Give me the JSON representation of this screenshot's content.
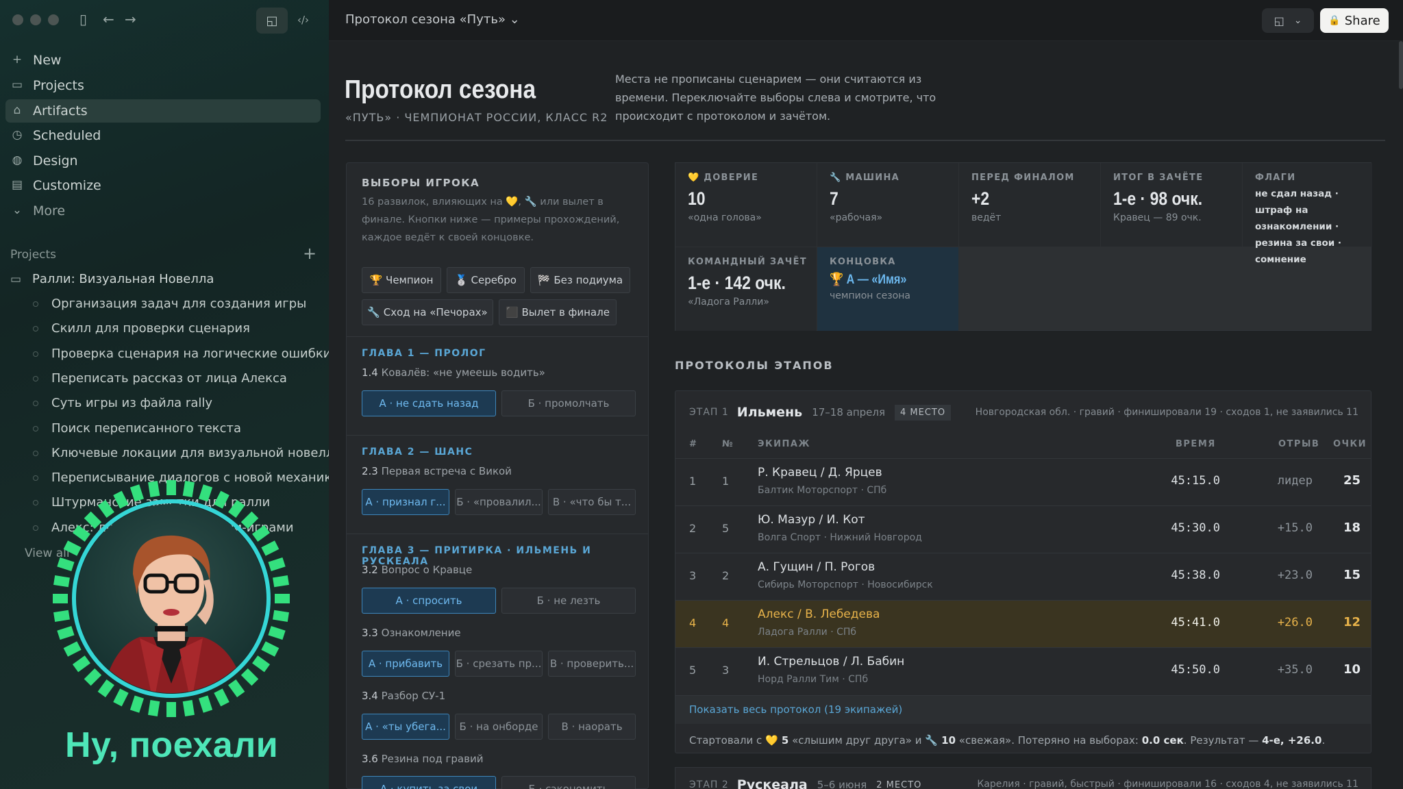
{
  "sidebar": {
    "nav": [
      {
        "label": "New",
        "icon": "plus-icon"
      },
      {
        "label": "Projects",
        "icon": "folder-icon"
      },
      {
        "label": "Artifacts",
        "icon": "artifacts-icon"
      },
      {
        "label": "Scheduled",
        "icon": "clock-icon"
      },
      {
        "label": "Design",
        "icon": "palette-icon"
      },
      {
        "label": "Customize",
        "icon": "briefcase-icon"
      },
      {
        "label": "More",
        "icon": "chevron-down-icon"
      }
    ],
    "projects_header": "Projects",
    "project_name": "Ралли: Визуальная Новелла",
    "items": [
      "Организация задач для создания игры",
      "Скилл для проверки сценария",
      "Проверка сценария на логические ошибки",
      "Переписать рассказ от лица Алекса",
      "Суть игры из файла rally",
      "Поиск переписанного текста",
      "Ключевые локации для визуальной новеллы",
      "Переписывание диалогов с новой механикой",
      "Штурманские заметки для ралли",
      "Алекс: диалоги с новой мини-играми"
    ],
    "view_all": "View all"
  },
  "overlay": {
    "caption": "Ну, поехали"
  },
  "topbar": {
    "title": "Протокол сезона «Путь» ⌄",
    "share": "Share"
  },
  "header": {
    "title": "Протокол сезона",
    "subtitle": "«ПУТЬ» · ЧЕМПИОНАТ РОССИИ, КЛАСС R2",
    "intro": "Места не прописаны сценарием — они считаются из времени. Переключайте выборы слева и смотрите, что происходит с протоколом и зачётом."
  },
  "choices": {
    "title": "ВЫБОРЫ ИГРОКА",
    "desc": "16 развилок, влияющих на 💛, 🔧 или вылет в финале. Кнопки ниже — примеры прохождений, каждое ведёт к своей концовке.",
    "presets": [
      "🏆 Чемпион",
      "🥈 Серебро",
      "🏁 Без подиума",
      "🔧 Сход на «Печорах»",
      "⬛ Вылет в финале"
    ],
    "chapters": [
      {
        "title": "ГЛАВА 1 — ПРОЛОГ",
        "questions": [
          {
            "num": "1.4",
            "text": "Ковалёв: «не умеешь водить»",
            "options": [
              "А · не сдать назад",
              "Б · промолчать"
            ]
          }
        ]
      },
      {
        "title": "ГЛАВА 2 — ШАНС",
        "questions": [
          {
            "num": "2.3",
            "text": "Первая встреча с Викой",
            "options": [
              "А · признал г...",
              "Б · «провалил...",
              "В · «что бы т..."
            ]
          }
        ]
      },
      {
        "title": "ГЛАВА 3 — ПРИТИРКА · ИЛЬМЕНЬ И РУСКЕАЛА",
        "questions": [
          {
            "num": "3.2",
            "text": "Вопрос о Кравце",
            "options": [
              "А · спросить",
              "Б · не лезть"
            ]
          },
          {
            "num": "3.3",
            "text": "Ознакомление",
            "options": [
              "А · прибавить",
              "Б · срезать пр...",
              "В · проверить..."
            ]
          },
          {
            "num": "3.4",
            "text": "Разбор СУ-1",
            "options": [
              "А · «ты убега...",
              "Б · на онборде",
              "В · наорать"
            ]
          },
          {
            "num": "3.6",
            "text": "Резина под гравий",
            "options": [
              "А · купить за свои",
              "Б · сэкономить"
            ]
          }
        ]
      }
    ]
  },
  "stats": [
    {
      "label": "💛 ДОВЕРИЕ",
      "value": "10",
      "note": "«одна голова»"
    },
    {
      "label": "🔧 МАШИНА",
      "value": "7",
      "note": "«рабочая»"
    },
    {
      "label": "ПЕРЕД ФИНАЛОМ",
      "value": "+2",
      "note": "ведёт"
    },
    {
      "label": "ИТОГ В ЗАЧЁТЕ",
      "value": "1-е · 98 очк.",
      "note": "Кравец — 89 очк."
    },
    {
      "label": "ФЛАГИ",
      "value": "не сдал назад · штраф на ознакомлении · резина за свои · сомнение"
    },
    {
      "label": "КОМАНДНЫЙ ЗАЧЁТ",
      "value": "1-е · 142 очк.",
      "note": "«Ладога Ралли»"
    },
    {
      "label": "КОНЦОВКА",
      "value": "🏆 А — «Имя»",
      "note": "чемпион сезона"
    }
  ],
  "protocols": {
    "title": "ПРОТОКОЛЫ ЭТАПОВ",
    "stage": {
      "prefix": "ЭТАП 1",
      "name": "Ильмень",
      "dates": "17–18 апреля",
      "place": "4 МЕСТО",
      "info": "Новгородская обл. · гравий · финишировали 19 · сходов 1, не заявились 11"
    },
    "columns": [
      "#",
      "№",
      "ЭКИПАЖ",
      "ВРЕМЯ",
      "ОТРЫВ",
      "ОЧКИ"
    ],
    "rows": [
      {
        "pos": "1",
        "num": "1",
        "crew": "Р. Кравец / Д. Ярцев",
        "team": "Балтик Моторспорт · СПб",
        "time": "45:15.0",
        "gap": "лидер",
        "pts": "25"
      },
      {
        "pos": "2",
        "num": "5",
        "crew": "Ю. Мазур / И. Кот",
        "team": "Волга Спорт · Нижний Новгород",
        "time": "45:30.0",
        "gap": "+15.0",
        "pts": "18"
      },
      {
        "pos": "3",
        "num": "2",
        "crew": "А. Гущин / П. Рогов",
        "team": "Сибирь Моторспорт · Новосибирск",
        "time": "45:38.0",
        "gap": "+23.0",
        "pts": "15"
      },
      {
        "pos": "4",
        "num": "4",
        "crew": "Алекс / В. Лебедева",
        "team": "Ладога Ралли · СПб",
        "time": "45:41.0",
        "gap": "+26.0",
        "pts": "12"
      },
      {
        "pos": "5",
        "num": "3",
        "crew": "И. Стрельцов / Л. Бабин",
        "team": "Норд Ралли Тим · СПб",
        "time": "45:50.0",
        "gap": "+35.0",
        "pts": "10"
      }
    ],
    "show_all": "Показать весь протокол (19 экипажей)",
    "summary_start": "Стартовали с ",
    "summary_trust": "💛 5",
    "summary_mid": " «слышим друг друга» и ",
    "summary_car": "🔧 10",
    "summary_mid2": " «свежая». Потеряно на выборах: ",
    "summary_lost": "0.0 сек",
    "summary_res": ". Результат — ",
    "summary_result": "4-е, +26.0",
    "summary_end": ".",
    "next_stage": {
      "prefix": "ЭТАП 2",
      "name": "Рускеала",
      "dates": "5–6 июня",
      "place": "2 МЕСТО",
      "info": "Карелия · гравий, быстрый · финишировали 16 · сходов 4, не заявились 11"
    }
  },
  "colors": {
    "accent_blue": "#5aa7d6",
    "highlight_gold": "#e8b34a",
    "ring_green": "#34e07e",
    "caption": "#4ee6b8"
  }
}
